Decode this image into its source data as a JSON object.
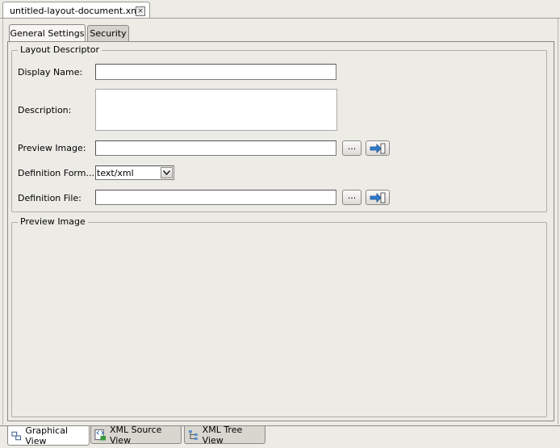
{
  "document_tab": {
    "title": "untitled-layout-document.xml",
    "close_glyph": "×"
  },
  "tabs": {
    "general": "General Settings",
    "security": "Security"
  },
  "layout_descriptor": {
    "title": "Layout Descriptor",
    "display_name_label": "Display Name:",
    "display_name_value": "",
    "description_label": "Description:",
    "description_value": "",
    "preview_image_label": "Preview Image:",
    "preview_image_value": "",
    "browse_label": "...",
    "definition_format_label": "Definition Form...",
    "definition_format_value": "text/xml",
    "definition_file_label": "Definition File:",
    "definition_file_value": ""
  },
  "preview_section": {
    "title": "Preview Image"
  },
  "view_tabs": {
    "graphical": "Graphical View",
    "xml_source": "XML Source View",
    "xml_tree": "XML Tree View"
  },
  "icons": {
    "close": "close-icon",
    "browse": "ellipsis-icon",
    "open": "arrow-right-icon",
    "dropdown": "chevron-down-icon",
    "graphical": "graphical-view-icon",
    "xml_source": "xml-source-icon",
    "xml_tree": "tree-view-icon"
  }
}
